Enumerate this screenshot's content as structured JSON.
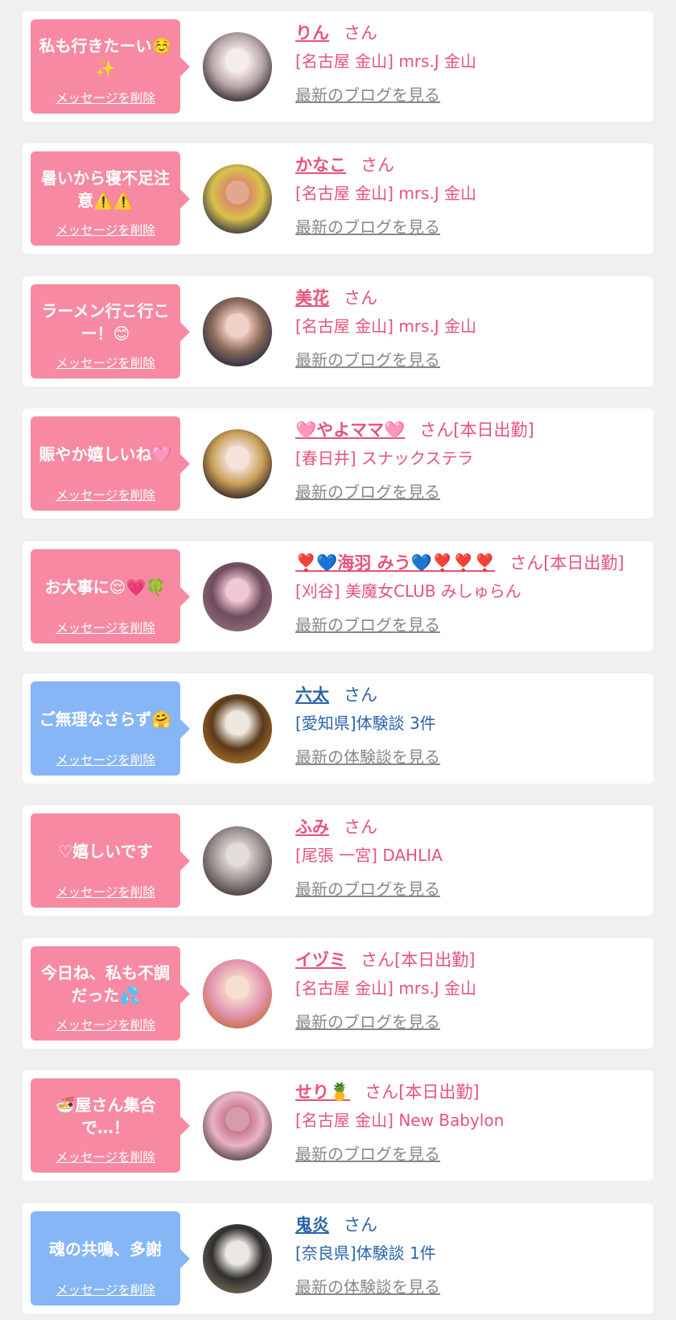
{
  "colors": {
    "pink_bubble": "#f78aa2",
    "blue_bubble": "#86b6f6",
    "pink_text": "#e6537a",
    "blue_text": "#2a64a8",
    "link_gray": "#888888"
  },
  "cards": [
    {
      "theme": "pink",
      "message": "私も行きたーい☺️✨",
      "delete_label": "メッセージを削除",
      "name": "りん",
      "suffix": "さん",
      "shop": "[名古屋 金山] mrs.J 金山",
      "latest_link": "最新のブログを見る",
      "avatar_colors": [
        "#3a3034",
        "#efe7e4",
        "#b8a7a8"
      ]
    },
    {
      "theme": "pink",
      "message": "暑いから寝不足注意⚠️⚠️",
      "delete_label": "メッセージを削除",
      "name": "かなこ",
      "suffix": "さん",
      "shop": "[名古屋 金山] mrs.J 金山",
      "latest_link": "最新のブログを見る",
      "avatar_colors": [
        "#3e3a45",
        "#d98a6a",
        "#d8c24a"
      ]
    },
    {
      "theme": "pink",
      "message": "ラーメン行こ行こー！😊",
      "delete_label": "メッセージを削除",
      "name": "美花",
      "suffix": "さん",
      "shop": "[名古屋 金山] mrs.J 金山",
      "latest_link": "最新のブログを見る",
      "avatar_colors": [
        "#2f2f45",
        "#e9c3b6",
        "#8a6a5a"
      ]
    },
    {
      "theme": "pink",
      "message": "賑やか嬉しいね🩷",
      "delete_label": "メッセージを削除",
      "name": "🩷やよママ🩷",
      "suffix": "さん[本日出勤]",
      "shop": "[春日井] スナックステラ",
      "latest_link": "最新のブログを見る",
      "avatar_colors": [
        "#3b2a26",
        "#f0d9cf",
        "#c9a15a"
      ]
    },
    {
      "theme": "pink",
      "message": "お大事に😌💗🍀",
      "delete_label": "メッセージを削除",
      "name": "❣️💙海羽 みう💙❣️❣️❣️",
      "suffix": "さん[本日出勤]",
      "shop": "[刈谷] 美魔女CLUB みしゅらん",
      "latest_link": "最新のブログを見る",
      "avatar_colors": [
        "#8c6a7a",
        "#e6b7c7",
        "#6e4c5e"
      ]
    },
    {
      "theme": "blue",
      "message": "ご無理なさらず🤗",
      "delete_label": "メッセージを削除",
      "name": "六太",
      "suffix": "さん",
      "shop": "[愛知県]体験談 3件",
      "latest_link": "最新の体験談を見る",
      "avatar_colors": [
        "#a06a2a",
        "#e9e2d5",
        "#5a3a1a"
      ]
    },
    {
      "theme": "pink",
      "message": "♡嬉しいです",
      "delete_label": "メッセージを削除",
      "name": "ふみ",
      "suffix": "さん",
      "shop": "[尾張 一宮] DAHLIA",
      "latest_link": "最新のブログを見る",
      "avatar_colors": [
        "#4a3f3d",
        "#d8d1cf",
        "#9a9290"
      ]
    },
    {
      "theme": "pink",
      "message": "今日ね、私も不調だった💦",
      "delete_label": "メッセージを削除",
      "name": "イヅミ",
      "suffix": "さん[本日出勤]",
      "shop": "[名古屋 金山] mrs.J 金山",
      "latest_link": "最新のブログを見る",
      "avatar_colors": [
        "#c8714e",
        "#f3d3c2",
        "#e59ab8"
      ]
    },
    {
      "theme": "pink",
      "message": "🍜屋さん集合で…！",
      "delete_label": "メッセージを削除",
      "name": "せり🍍",
      "suffix": "さん[本日出勤]",
      "shop": "[名古屋 金山] New Babylon",
      "latest_link": "最新のブログを見る",
      "avatar_colors": [
        "#5a4a48",
        "#c77a8e",
        "#e9b3c7"
      ]
    },
    {
      "theme": "blue",
      "message": "魂の共鳴、多謝",
      "delete_label": "メッセージを削除",
      "name": "鬼炎",
      "suffix": "さん",
      "shop": "[奈良県]体験談 1件",
      "latest_link": "最新の体験談を見る",
      "avatar_colors": [
        "#6d6356",
        "#e3e0d8",
        "#2f2f2f"
      ]
    }
  ]
}
